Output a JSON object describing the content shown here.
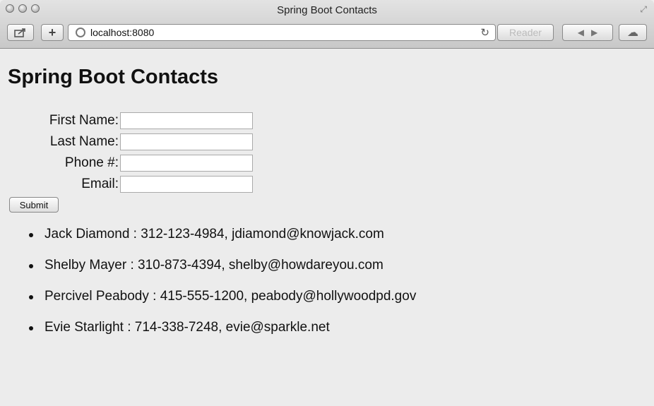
{
  "window": {
    "title": "Spring Boot Contacts"
  },
  "toolbar": {
    "share_icon": "share-icon",
    "add_label": "+",
    "url": "localhost:8080",
    "reload_icon": "↻",
    "reader_label": "Reader",
    "back_icon": "◀",
    "forward_icon": "▶",
    "cloud_icon": "☁"
  },
  "page": {
    "heading": "Spring Boot Contacts",
    "form": {
      "first_name_label": "First Name:",
      "last_name_label": "Last Name:",
      "phone_label": "Phone #:",
      "email_label": "Email:",
      "first_name_value": "",
      "last_name_value": "",
      "phone_value": "",
      "email_value": "",
      "submit_label": "Submit"
    },
    "contacts": [
      "Jack Diamond : 312-123-4984, jdiamond@knowjack.com",
      "Shelby Mayer : 310-873-4394, shelby@howdareyou.com",
      "Percivel Peabody : 415-555-1200, peabody@hollywoodpd.gov",
      "Evie Starlight : 714-338-7248, evie@sparkle.net"
    ]
  }
}
